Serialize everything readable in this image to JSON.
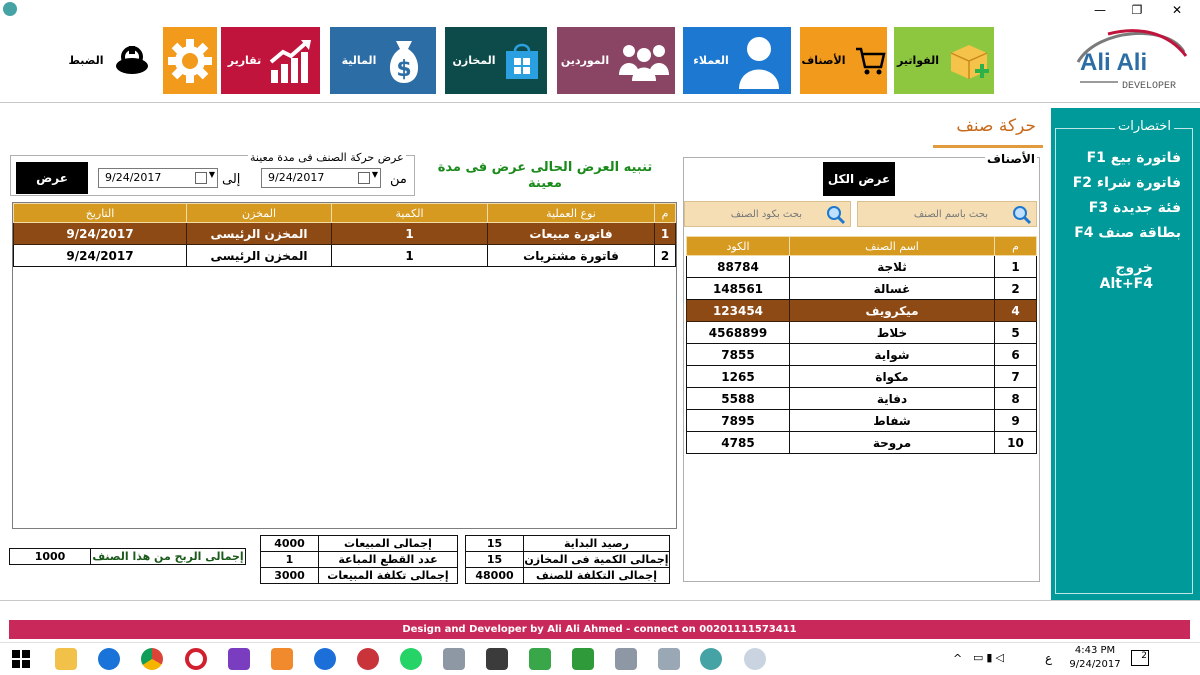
{
  "window": {
    "minimize": "—",
    "restore": "❐",
    "close": "✕"
  },
  "ribbon": [
    {
      "label": "الضبط",
      "bg": "#ffffff",
      "fg": "#000000",
      "icon": "steering-wheel-icon"
    },
    {
      "label": "",
      "bg": "#f29a1c",
      "fg": "#ffffff",
      "icon": "gear-icon"
    },
    {
      "label": "تقارير",
      "bg": "#c0143c",
      "fg": "#ffffff",
      "icon": "chart-growth-icon"
    },
    {
      "label": "المالية",
      "bg": "#2d6da5",
      "fg": "#ffffff",
      "icon": "money-bag-icon"
    },
    {
      "label": "المخازن",
      "bg": "#0d4a4a",
      "fg": "#ffffff",
      "icon": "store-icon"
    },
    {
      "label": "الموردين",
      "bg": "#8a4565",
      "fg": "#ffffff",
      "icon": "group-icon"
    },
    {
      "label": "العملاء",
      "bg": "#1c78d0",
      "fg": "#ffffff",
      "icon": "user-icon"
    },
    {
      "label": "الأصناف",
      "bg": "#f29a1c",
      "fg": "#000000",
      "icon": "cart-icon"
    },
    {
      "label": "الفواتير",
      "bg": "#8dc63f",
      "fg": "#000000",
      "icon": "invoice-box-icon"
    }
  ],
  "logo": {
    "main": "Ali Ali",
    "sub": "DEVELOPER"
  },
  "page": {
    "title": "حركة صنف"
  },
  "shortcuts": {
    "title": "اختصارات",
    "items": [
      "فاتورة بيع  F1",
      "فاتورة شراء  F2",
      "فئة جديدة  F3",
      "بطاقة صنف  F4",
      "خروج  Alt+F4"
    ]
  },
  "filter": {
    "legend": "عرض حركة الصنف فى مدة معينة",
    "from_label": "من",
    "to_label": "إلى",
    "from_date": "9/24/2017",
    "to_date": "9/24/2017",
    "show_button": "عرض",
    "notice": "تنبيه العرض الحالى عرض فى مدة معينة"
  },
  "movements": {
    "headers": [
      "م",
      "نوع العملية",
      "الكمية",
      "المخزن",
      "التاريخ"
    ],
    "rows": [
      [
        "1",
        "فاتورة مبيعات",
        "1",
        "المخزن الرئيسى",
        "9/24/2017"
      ],
      [
        "2",
        "فاتورة مشتريات",
        "1",
        "المخزن الرئيسى",
        "9/24/2017"
      ]
    ]
  },
  "items": {
    "legend": "الأصناف",
    "show_all": "عرض الكل",
    "search_by_name": "بحث باسم الصنف",
    "search_by_code": "بحث بكود الصنف",
    "headers": [
      "م",
      "اسم الصنف",
      "الكود"
    ],
    "rows": [
      [
        "1",
        "ثلاجة",
        "88784"
      ],
      [
        "2",
        "غسالة",
        "148561"
      ],
      [
        "4",
        "ميكرويف",
        "123454"
      ],
      [
        "5",
        "خلاط",
        "4568899"
      ],
      [
        "6",
        "شواية",
        "7855"
      ],
      [
        "7",
        "مكواة",
        "1265"
      ],
      [
        "8",
        "دفاية",
        "5588"
      ],
      [
        "9",
        "شفاط",
        "7895"
      ],
      [
        "10",
        "مروحة",
        "4785"
      ]
    ]
  },
  "totals_left": [
    {
      "label": "إجمالى المبيعات",
      "value": "4000"
    },
    {
      "label": "عدد القطع المباعة",
      "value": "1"
    },
    {
      "label": "إجمالى تكلفة المبيعات",
      "value": "3000"
    }
  ],
  "totals_right": [
    {
      "label": "رصيد البداية",
      "value": "15"
    },
    {
      "label": "إجمالى الكمية فى المخازن",
      "value": "15"
    },
    {
      "label": "إجمالى التكلفة للصنف",
      "value": "48000"
    }
  ],
  "profit": {
    "label": "إجمالى الربح من هذا الصنف",
    "value": "1000"
  },
  "footer": "Design and Developer by Ali Ali Ahmed - connect on 00201111573411",
  "taskbar": {
    "time": "4:43 PM",
    "date": "9/24/2017",
    "lang": "ع",
    "notifications": "2"
  }
}
